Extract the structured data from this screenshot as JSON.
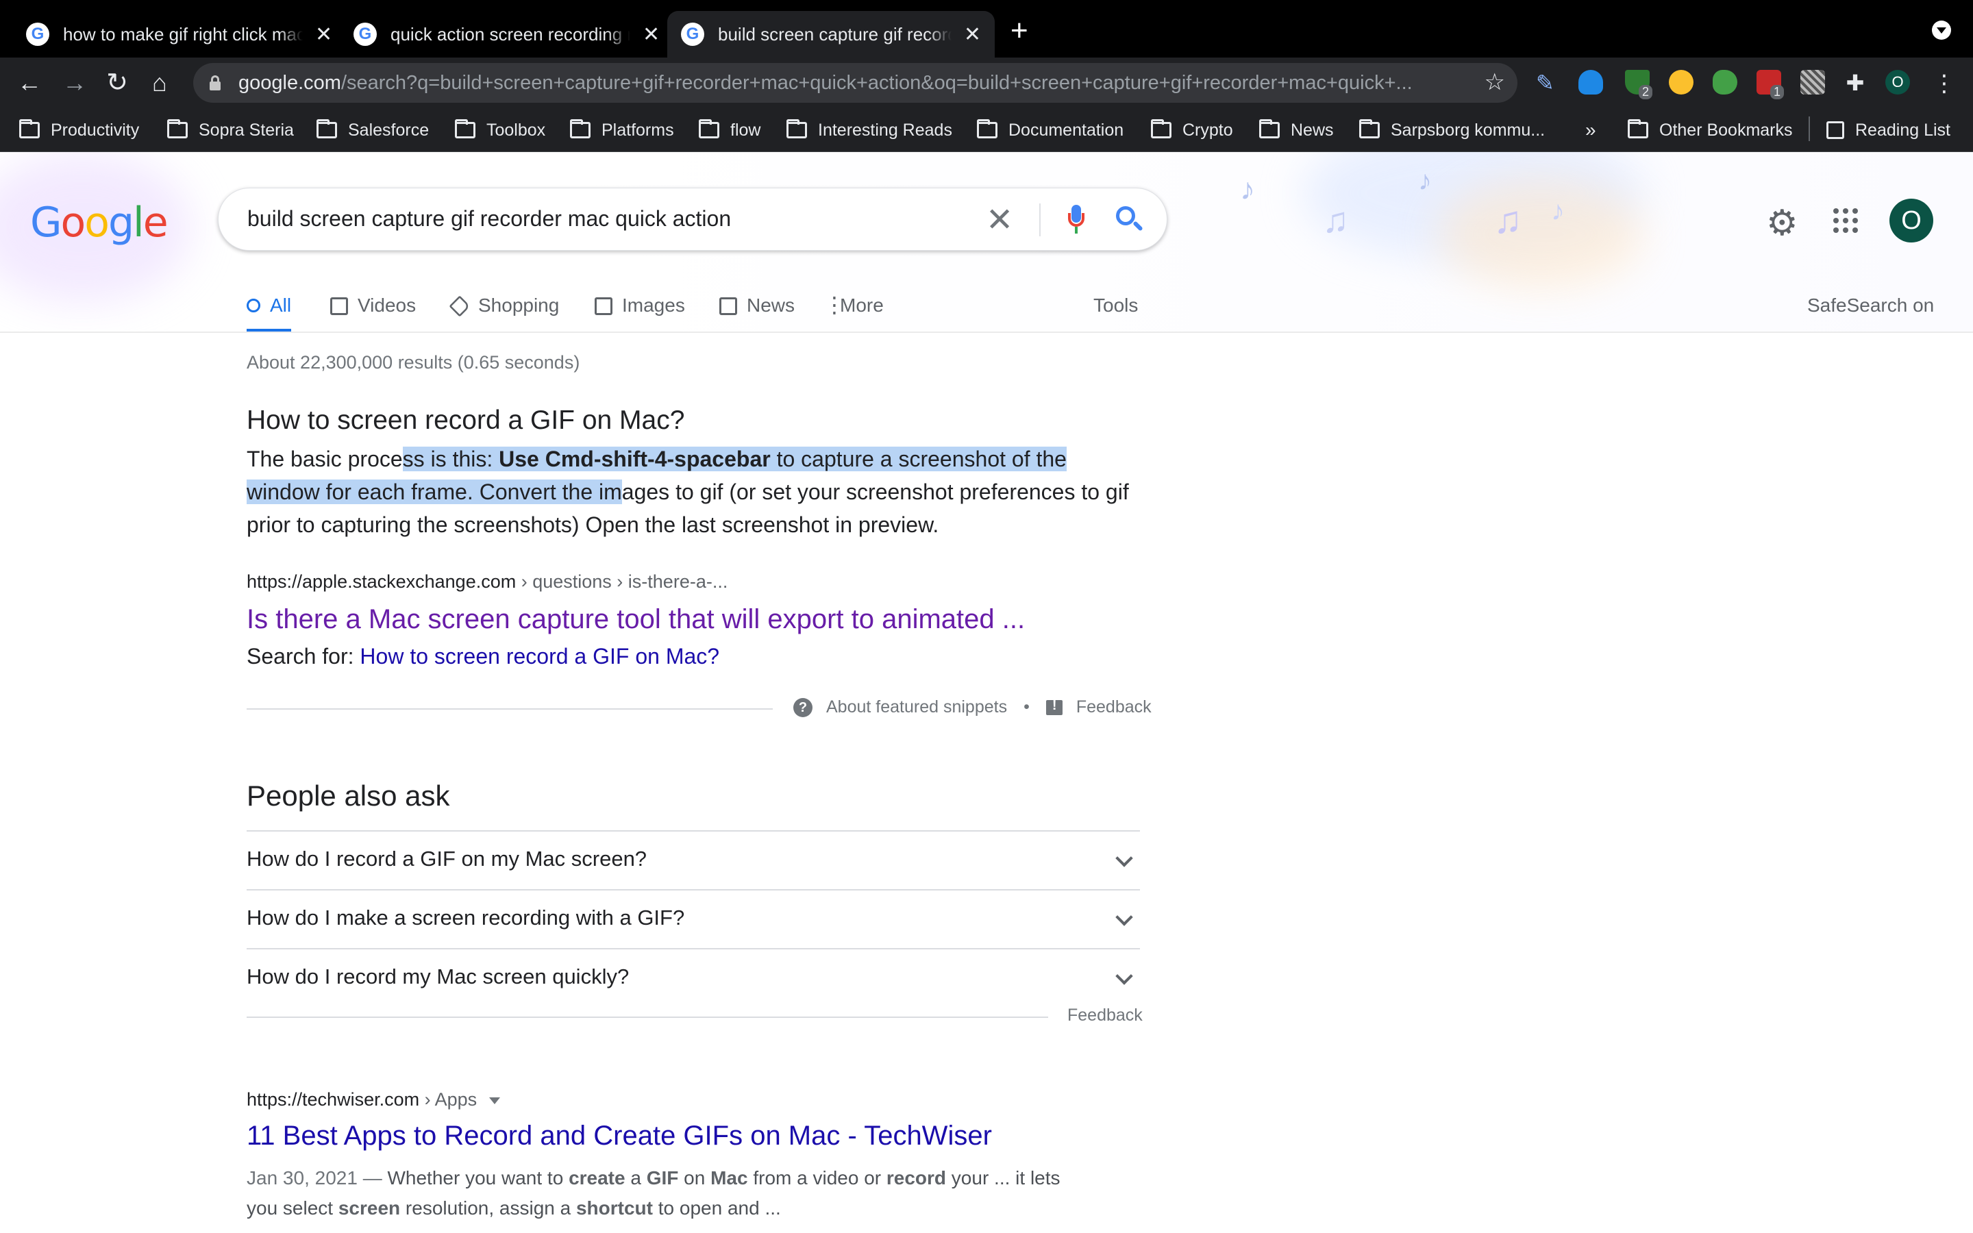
{
  "browser": {
    "tabs": [
      {
        "title": "how to make gif right click mac",
        "active": false
      },
      {
        "title": "quick action screen recording mac",
        "active": false
      },
      {
        "title": "build screen capture gif recorder",
        "active": true
      }
    ],
    "url_host": "google.com",
    "url_rest": "/search?q=build+screen+capture+gif+recorder+mac+quick+action&oq=build+screen+capture+gif+recorder+mac+quick+...",
    "profile_initial": "O",
    "extension_badges": {
      "shield": "2",
      "calendar": "1"
    },
    "bookmarks": [
      "Productivity",
      "Sopra Steria",
      "Salesforce",
      "Toolbox",
      "Platforms",
      "flow",
      "Interesting Reads",
      "Documentation",
      "Crypto",
      "News",
      "Sarpsborg kommu..."
    ],
    "bookmarks_overflow": "»",
    "other_bookmarks": "Other Bookmarks",
    "reading_list": "Reading List"
  },
  "search": {
    "query": "build screen capture gif recorder mac quick action",
    "logo_text": "Google",
    "avatar_initial": "O",
    "tabs": [
      "All",
      "Videos",
      "Shopping",
      "Images",
      "News",
      "More"
    ],
    "tools": "Tools",
    "safesearch": "SafeSearch on"
  },
  "results": {
    "stats": "About 22,300,000 results (0.65 seconds)",
    "featured": {
      "question": "How to screen record a GIF on Mac?",
      "body_1": "The basic proce",
      "body_2": "ss is this: ",
      "body_bold": "Use Cmd-shift-4-spacebar",
      "body_3": " to capture a screenshot of the window for each frame. Convert the im",
      "body_4": "ages to gif (or set your screenshot preferences to gif prior to capturing the screenshots) Open the last screenshot in preview.",
      "url": "https://apple.stackexchange.com",
      "breadcrumb": " › questions › is-there-a-...",
      "title": "Is there a Mac screen capture tool that will export to animated ...",
      "search_for_label": "Search for: ",
      "search_for_link": "How to screen record a GIF on Mac?",
      "about": "About featured snippets",
      "separator": "•",
      "feedback": "Feedback"
    },
    "paa": {
      "title": "People also ask",
      "questions": [
        "How do I record a GIF on my Mac screen?",
        "How do I make a screen recording with a GIF?",
        "How do I record my Mac screen quickly?"
      ],
      "feedback": "Feedback"
    },
    "result2": {
      "url": "https://techwiser.com",
      "breadcrumb": " › Apps",
      "title": "11 Best Apps to Record and Create GIFs on Mac - TechWiser",
      "date": "Jan 30, 2021 — ",
      "snippet_1": "Whether you want to ",
      "b1": "create",
      "s2": " a ",
      "b2": "GIF",
      "s3": " on ",
      "b3": "Mac",
      "s4": " from a video or ",
      "b4": "record",
      "s5": " your ... it lets you select ",
      "b5": "screen",
      "s6": " resolution, assign a ",
      "b6": "shortcut",
      "s7": " to open and ..."
    }
  },
  "colors": {
    "link": "#1a0dab",
    "visited": "#681da8",
    "accent": "#1a73e8",
    "selection": "#b8d4f5",
    "chrome_dark": "#202124"
  }
}
